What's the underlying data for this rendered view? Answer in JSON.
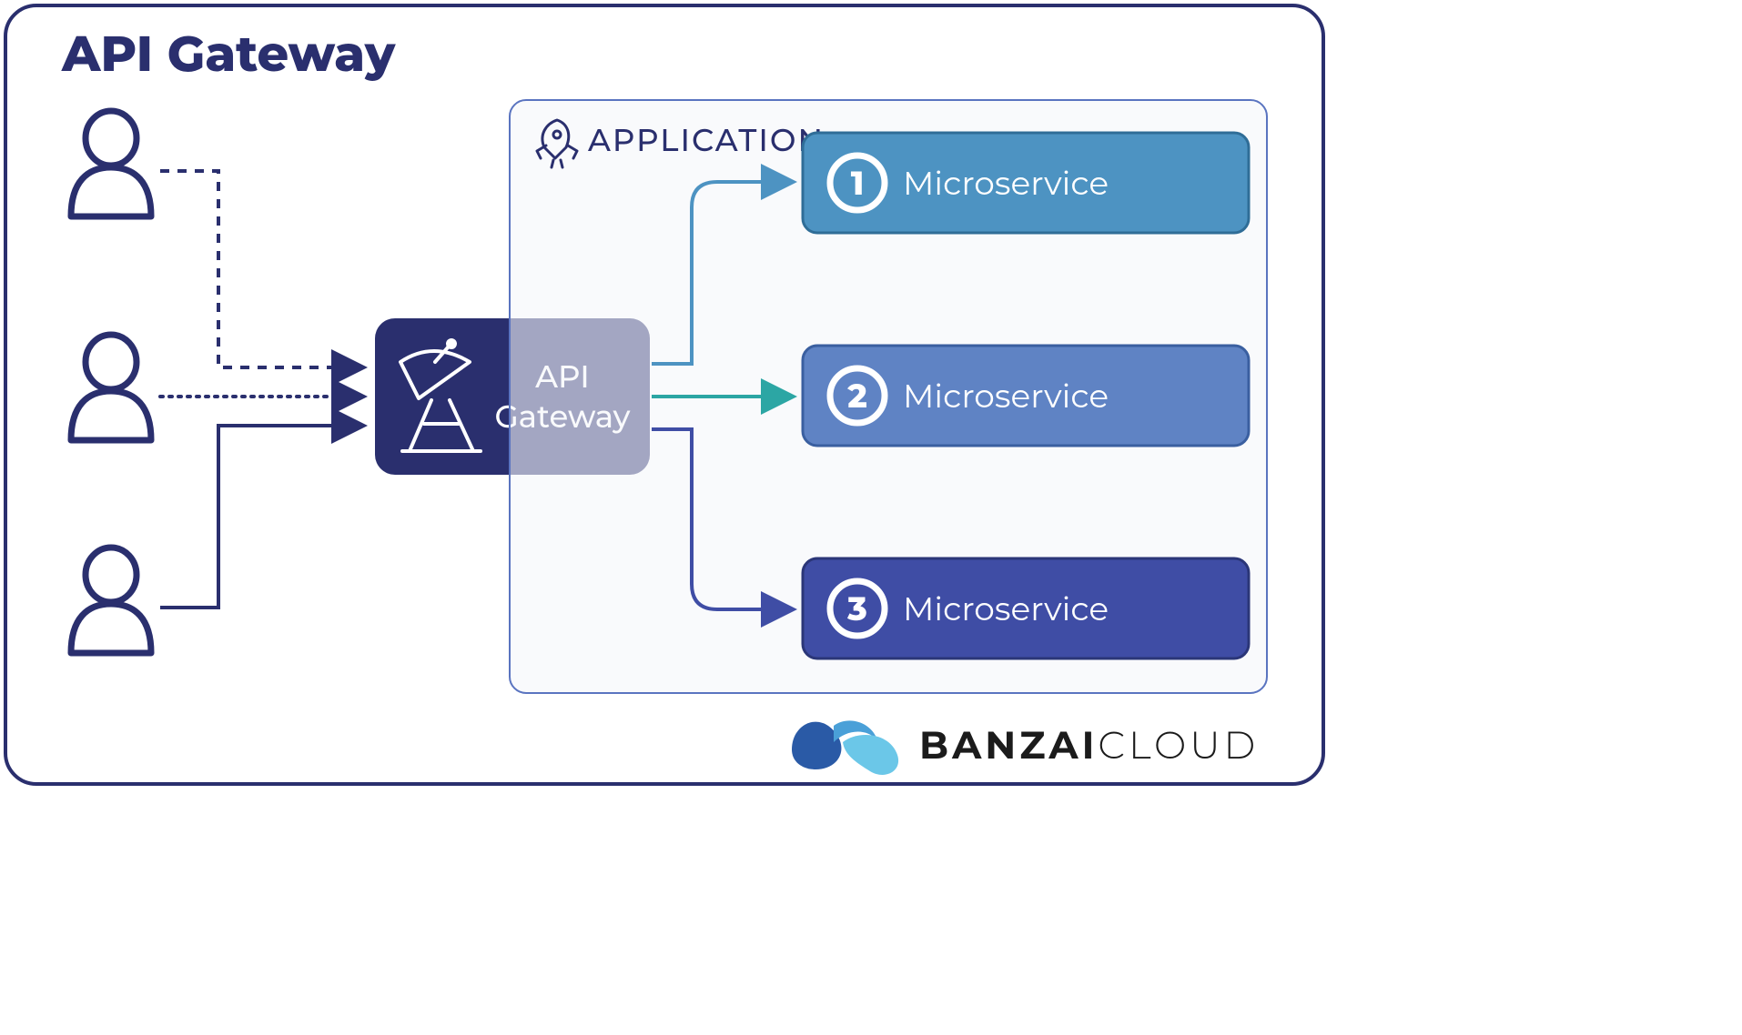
{
  "title": "API Gateway",
  "gateway": {
    "line1": "API",
    "line2": "Gateway"
  },
  "application": {
    "label": "APPLICATION"
  },
  "microservices": [
    {
      "num": "1",
      "label": "Microservice",
      "fill": "#4d93c2",
      "stroke": "#2f6d97"
    },
    {
      "num": "2",
      "label": "Microservice",
      "fill": "#5f83c4",
      "stroke": "#3a5fa0"
    },
    {
      "num": "3",
      "label": "Microservice",
      "fill": "#3f4da5",
      "stroke": "#2b3678"
    }
  ],
  "brand": {
    "bold": "BANZAI",
    "light": "CLOUD"
  },
  "colors": {
    "navy": "#2a2f6e",
    "panel": "#f5f7fa",
    "panelStroke": "#5a74c0",
    "arrow1": "#4d93c2",
    "arrow2": "#2ca6a4",
    "arrow3": "#3f4da5"
  }
}
